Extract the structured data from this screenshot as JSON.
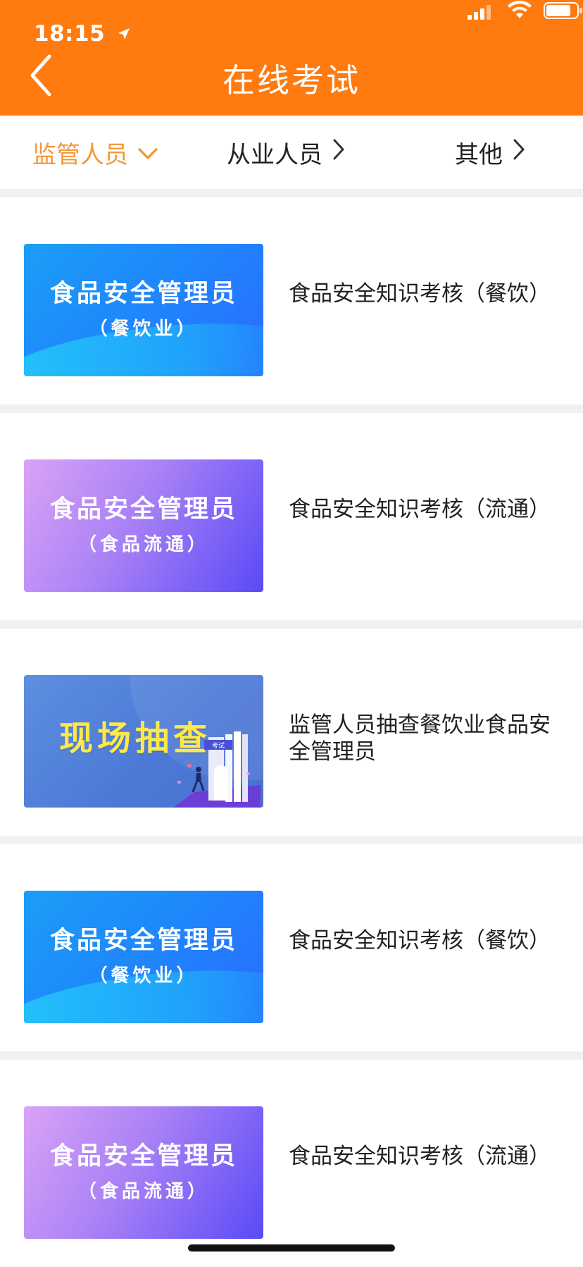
{
  "status_bar": {
    "time": "18:15"
  },
  "header": {
    "title": "在线考试",
    "background": "#ff7a0f"
  },
  "tabs": [
    {
      "label": "监管人员",
      "active": true
    },
    {
      "label": "从业人员",
      "active": false
    },
    {
      "label": "其他",
      "active": false
    }
  ],
  "items": [
    {
      "thumb": {
        "style": "blue",
        "line1": "食品安全管理员",
        "line2": "（餐饮业）"
      },
      "text": "食品安全知识考核（餐饮）"
    },
    {
      "thumb": {
        "style": "purple",
        "line1": "食品安全管理员",
        "line2": "（食品流通）"
      },
      "text": "食品安全知识考核（流通）"
    },
    {
      "thumb": {
        "style": "indigo",
        "big": "现场抽查",
        "sign": "考试"
      },
      "text": "监管人员抽查餐饮业食品安全管理员"
    },
    {
      "thumb": {
        "style": "blue",
        "line1": "食品安全管理员",
        "line2": "（餐饮业）"
      },
      "text": "食品安全知识考核（餐饮）"
    },
    {
      "thumb": {
        "style": "purple",
        "line1": "食品安全管理员",
        "line2": "（食品流通）"
      },
      "text": "食品安全知识考核（流通）"
    }
  ],
  "colors": {
    "accent": "#ff7a0f",
    "active_tab": "#f39a3a",
    "divider": "#f1f1f1"
  }
}
